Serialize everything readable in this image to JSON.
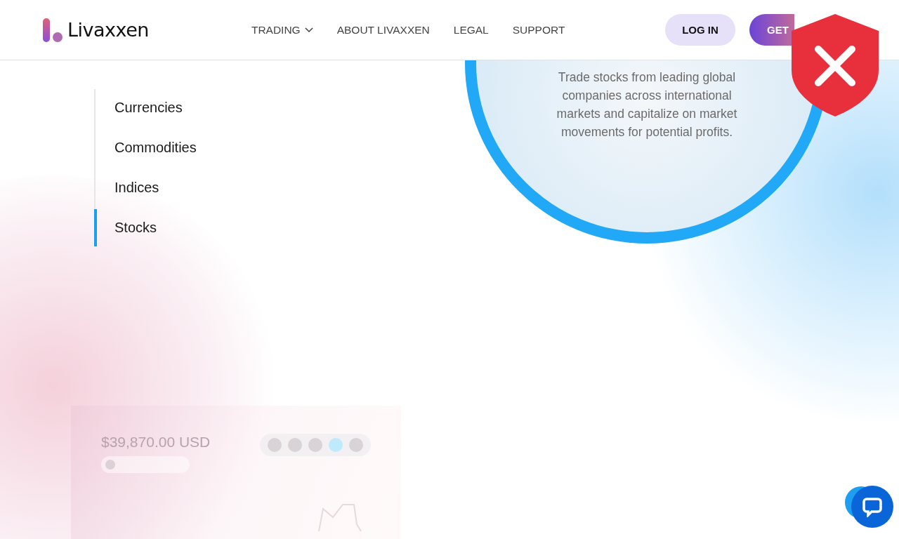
{
  "header": {
    "logo": "Livaxxen",
    "nav": [
      {
        "label": "TRADING",
        "kind": "dropdown"
      },
      {
        "label": "ABOUT LIVAXXEN",
        "kind": "link"
      },
      {
        "label": "LEGAL",
        "kind": "link"
      },
      {
        "label": "SUPPORT",
        "kind": "link"
      }
    ],
    "login": "LOG IN",
    "cta": "GET"
  },
  "markets": [
    {
      "label": "Currencies",
      "selected": false
    },
    {
      "label": "Commodities",
      "selected": false
    },
    {
      "label": "Indices",
      "selected": false
    },
    {
      "label": "Stocks",
      "selected": true
    }
  ],
  "feature": {
    "description": "Trade stocks from leading global companies across international markets and capitalize on market movements for potential profits."
  },
  "preview_card": {
    "price": "$39,870.00 USD",
    "periods": [
      {
        "selected": false
      },
      {
        "selected": false
      },
      {
        "selected": false
      },
      {
        "selected": true
      },
      {
        "selected": false
      }
    ]
  }
}
